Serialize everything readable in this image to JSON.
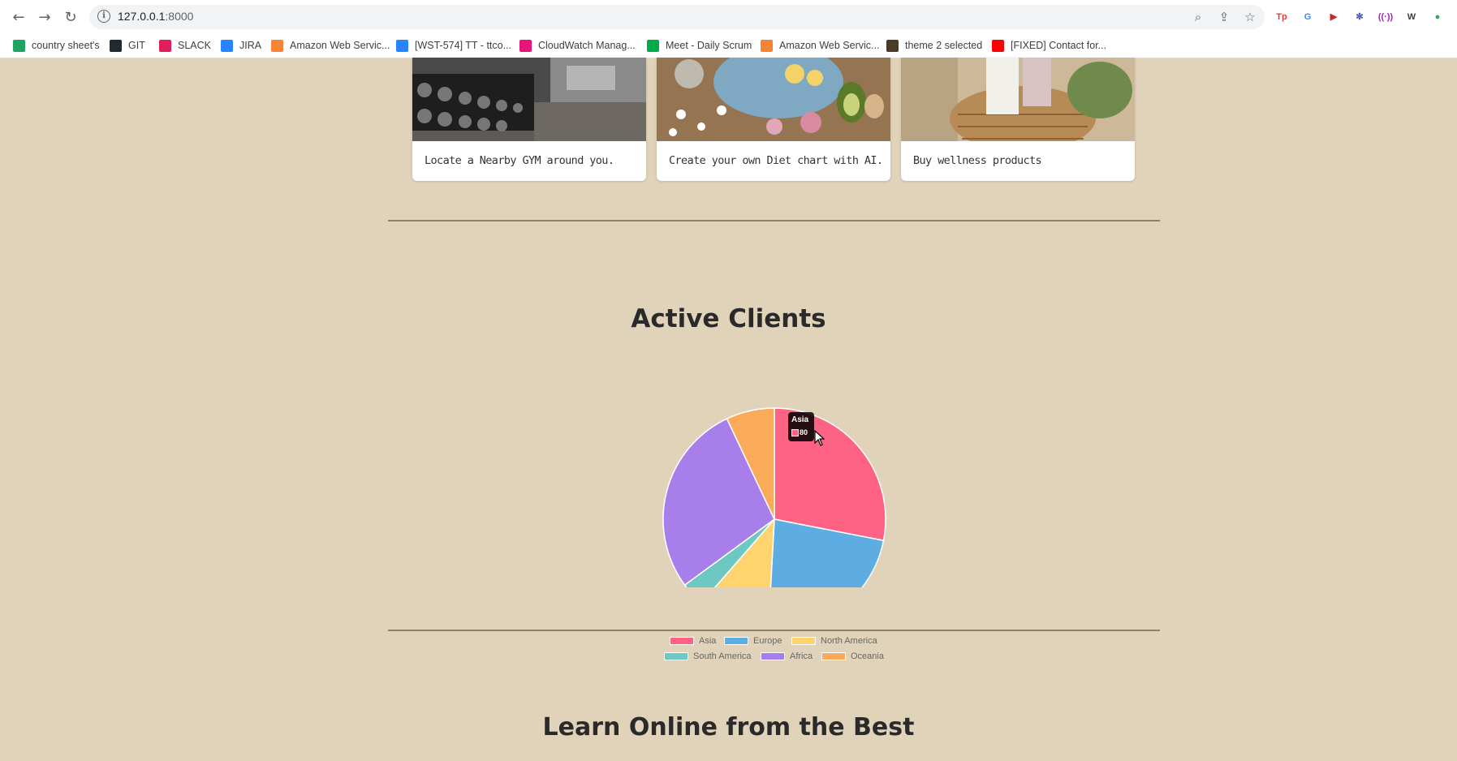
{
  "browser": {
    "url_host": "127.0.0.1",
    "url_port": ":8000",
    "bookmarks": [
      {
        "label": "country sheet's",
        "color": "#1fa463"
      },
      {
        "label": "GIT",
        "color": "#24292f"
      },
      {
        "label": "SLACK",
        "color": "#e01e5a"
      },
      {
        "label": "JIRA",
        "color": "#2684ff"
      },
      {
        "label": "Amazon Web Servic...",
        "color": "#f58534"
      },
      {
        "label": "[WST-574] TT - ttco...",
        "color": "#2684ff"
      },
      {
        "label": "CloudWatch Manag...",
        "color": "#e7157b"
      },
      {
        "label": "Meet - Daily Scrum",
        "color": "#00ac47"
      },
      {
        "label": "Amazon Web Servic...",
        "color": "#f58534"
      },
      {
        "label": "theme 2 selected",
        "color": "#4a3a2a"
      },
      {
        "label": "[FIXED] Contact for...",
        "color": "#ff0000"
      }
    ],
    "extensions": [
      {
        "name": "tp-extension-icon",
        "text": "Tp",
        "color": "#e53935"
      },
      {
        "name": "translate-extension-icon",
        "text": "G",
        "color": "#4285f4"
      },
      {
        "name": "video-extension-icon",
        "text": "▶",
        "color": "#c62828"
      },
      {
        "name": "snowflake-extension-icon",
        "text": "✻",
        "color": "#3f51b5"
      },
      {
        "name": "radio-extension-icon",
        "text": "((·))",
        "color": "#9c27b0"
      },
      {
        "name": "wordpress-extension-icon",
        "text": "W",
        "color": "#3c4043"
      },
      {
        "name": "color-extension-icon",
        "text": "●",
        "color": "#34a853"
      }
    ]
  },
  "cards": [
    {
      "text": "Locate a Nearby GYM around you."
    },
    {
      "text": "Create your own Diet chart with AI."
    },
    {
      "text": "Buy wellness products"
    }
  ],
  "sections": {
    "chart_title": "Active Clients",
    "next_title": "Learn Online from the Best"
  },
  "tooltip": {
    "title": "Asia",
    "value": "80"
  },
  "chart_data": {
    "type": "pie",
    "title": "Active Clients",
    "categories": [
      "Asia",
      "Europe",
      "North America",
      "South America",
      "Africa",
      "Oceania"
    ],
    "values": [
      80,
      65,
      30,
      10,
      80,
      20
    ],
    "colors": [
      "#ff6384",
      "#5dade2",
      "#ffd36e",
      "#6dc8c4",
      "#a87fea",
      "#fbaa5a"
    ],
    "legend": "bottom"
  }
}
